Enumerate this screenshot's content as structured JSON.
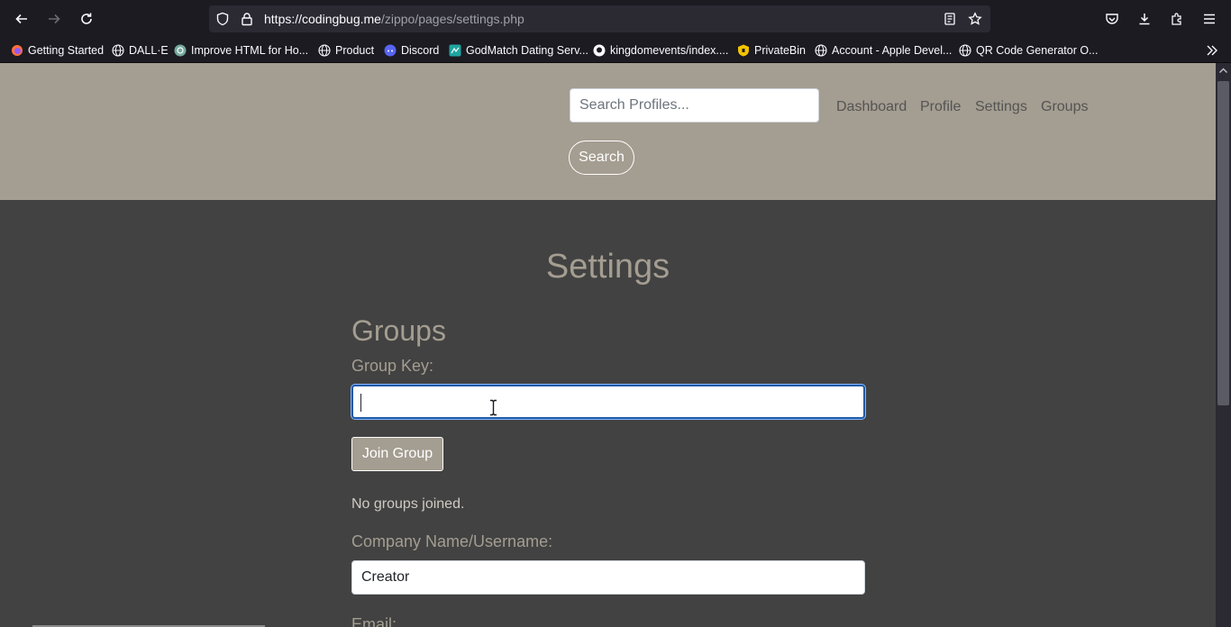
{
  "browser": {
    "url_host": "https://codingbug.me",
    "url_path": "/zippo/pages/settings.php",
    "bookmarks": [
      {
        "label": "Getting Started",
        "icon": "firefox-icon"
      },
      {
        "label": "DALL·E",
        "icon": "globe-icon"
      },
      {
        "label": "Improve HTML for Ho...",
        "icon": "openai-icon"
      },
      {
        "label": "Product",
        "icon": "globe-icon"
      },
      {
        "label": "Discord",
        "icon": "discord-icon"
      },
      {
        "label": "GodMatch Dating Serv...",
        "icon": "site-icon"
      },
      {
        "label": "kingdomevents/index....",
        "icon": "github-icon"
      },
      {
        "label": "PrivateBin",
        "icon": "privatebin-icon"
      },
      {
        "label": "Account - Apple Devel...",
        "icon": "globe-icon"
      },
      {
        "label": "QR Code Generator O...",
        "icon": "globe-icon"
      }
    ]
  },
  "header": {
    "search_placeholder": "Search Profiles...",
    "search_button": "Search",
    "nav": [
      "Dashboard",
      "Profile",
      "Settings",
      "Groups"
    ]
  },
  "main": {
    "title": "Settings",
    "groups_title": "Groups",
    "group_key_label": "Group Key:",
    "group_key_value": "",
    "join_button": "Join Group",
    "groups_status": "No groups joined.",
    "company_label": "Company Name/Username:",
    "company_value": "Creator",
    "email_label": "Email:"
  }
}
